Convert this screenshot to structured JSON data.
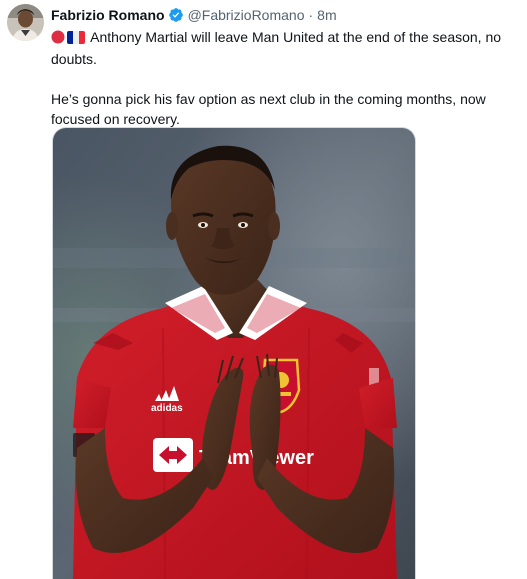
{
  "tweet": {
    "author": {
      "name": "Fabrizio Romano",
      "handle": "@FabrizioRomano",
      "verified": true,
      "avatar_icon": "profile-photo"
    },
    "separator": "·",
    "time": "8m",
    "paragraphs": [
      {
        "emojis": [
          "red-circle-emoji",
          "france-flag-emoji"
        ],
        "text": "Anthony Martial will leave Man United at the end of the season, no doubts."
      },
      {
        "text": "He’s gonna pick his fav option as next club in the coming months, now focused on recovery."
      }
    ],
    "media": {
      "description_icon": "football-player-photo",
      "jersey_brand": "adidas",
      "jersey_sponsor": "TeamViewer"
    }
  },
  "colors": {
    "text_primary": "#0f1419",
    "text_secondary": "#536471",
    "verified_blue": "#1d9bf0",
    "jersey_red": "#c8102e"
  }
}
